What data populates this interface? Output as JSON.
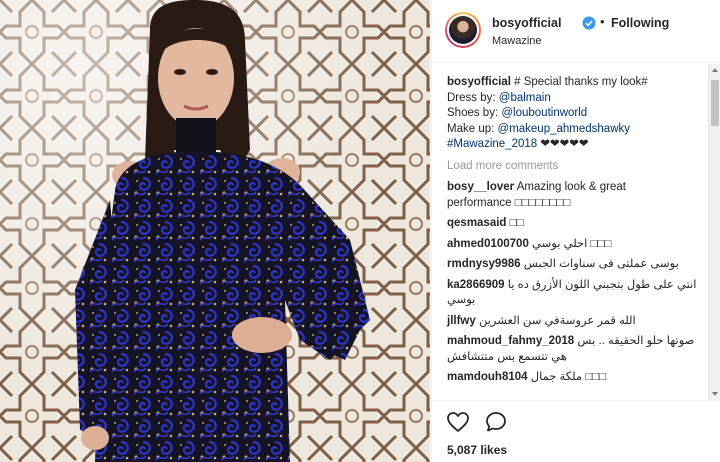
{
  "post": {
    "username": "bosyofficial",
    "separator": "•",
    "follow_status": "Following",
    "location": "Mawazine"
  },
  "caption": {
    "username": "bosyofficial",
    "text": "# Special thanks my look#",
    "dress_label": "Dress by:",
    "dress_handle": "@balmain",
    "shoes_label": "Shoes by:",
    "shoes_handle": "@louboutinworld",
    "makeup_label": "Make up:",
    "makeup_handle": "@makeup_ahmedshawky",
    "hashtag": "#Mawazine_2018",
    "hearts": "❤❤❤❤❤"
  },
  "load_more": "Load more comments",
  "comments": [
    {
      "user": "bosy__lover",
      "text": "Amazing look & great",
      "text2": "performance □□□□□□□□"
    },
    {
      "user": "qesmasaid",
      "text": "□□"
    },
    {
      "user": "ahmed0100700",
      "text": "□□□ احلي بوسي"
    },
    {
      "user": "rmdnysy9986",
      "text": "بوسى عملتى فى سناوات الجبس"
    },
    {
      "user": "ka2866909",
      "text": "انتي على طول بتجبني اللون الأزرق ده يا",
      "text2": "بوسي"
    },
    {
      "user": "jllfwy",
      "text": "الله قمر عروسةفي سن العشرين"
    },
    {
      "user": "mahmoud_fahmy_2018",
      "text": "صوتها حلو الحقيقه .. بس",
      "text2": "هي تتسمع بس متتشافش"
    },
    {
      "user": "mamdouh8104",
      "text": "□□□ ملكة جمال"
    }
  ],
  "likes": "5,087 likes",
  "icons": {
    "verified": "verified-badge-icon",
    "like": "heart-outline-icon",
    "comment": "speech-bubble-icon"
  },
  "colors": {
    "verified": "#3897f0",
    "link": "#003569",
    "muted": "#999999",
    "text": "#262626"
  }
}
